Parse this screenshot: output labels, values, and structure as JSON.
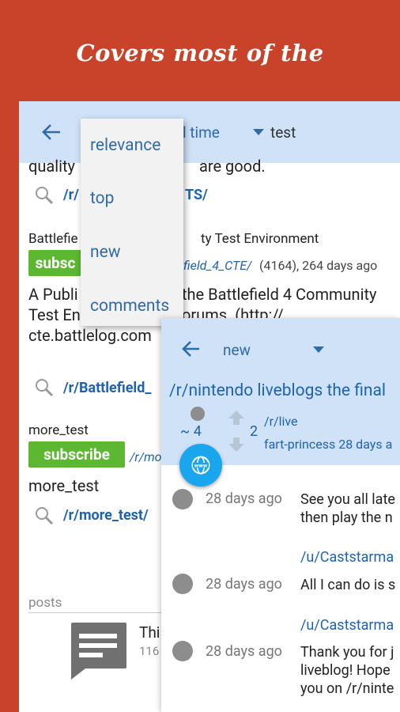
{
  "banner": {
    "text": "Covers most of the functionalities"
  },
  "back_screen": {
    "sort_label": "all time",
    "filter_label": "test",
    "results": [
      {
        "desc_fragment": "quality",
        "desc_fragment_2": "are good.",
        "link_fragment": "/r/",
        "link_fragment_2": "TS/"
      },
      {
        "title_fragment": "Battlefie",
        "title_fragment_2": "ty Test Environment",
        "subscribe": "subsc",
        "meta_fragment": "field_4_CTE/",
        "meta_counts": "(4164), 264 days ago",
        "desc_line1a": "A Publi",
        "desc_line1b": "the Battlefield 4 Community",
        "desc_line2a": "Test En",
        "desc_line2b": "orums. (http://",
        "desc_line3": "cte.battlelog.com",
        "link": "/r/Battlefield_"
      },
      {
        "title": "more_test",
        "subscribe": "subscribe",
        "meta_fragment": "/r/mo",
        "desc": "more_test",
        "link": "/r/more_test/"
      }
    ],
    "posts_label": "posts",
    "post_title_fragment": "Thi",
    "post_meta_fragment": "116"
  },
  "sort_menu": {
    "items": [
      "relevance",
      "top",
      "new",
      "comments"
    ]
  },
  "front_screen": {
    "sort_label": "new",
    "title": "/r/nintendo liveblogs the final",
    "score": "~ 4",
    "votes": "2",
    "subreddit": "/r/live",
    "author_time": "fart-princess 28 days a",
    "comments": [
      {
        "time": "28 days ago",
        "line1": "See you all late",
        "line2": "then play the n"
      },
      {
        "user": "/u/Caststarma",
        "time": "28 days ago",
        "line1": "All I can do is s"
      },
      {
        "user": "/u/Caststarma",
        "time": "28 days ago",
        "line1": "Thank you for j",
        "line2": "liveblog! Hope",
        "line3": "you on /r/ninte"
      }
    ]
  },
  "colors": {
    "banner_bg": "#c8432a",
    "header_bg": "#cfe2f7",
    "link": "#1e63b0",
    "subscribe": "#5cb731",
    "fab": "#1aa6ee"
  }
}
